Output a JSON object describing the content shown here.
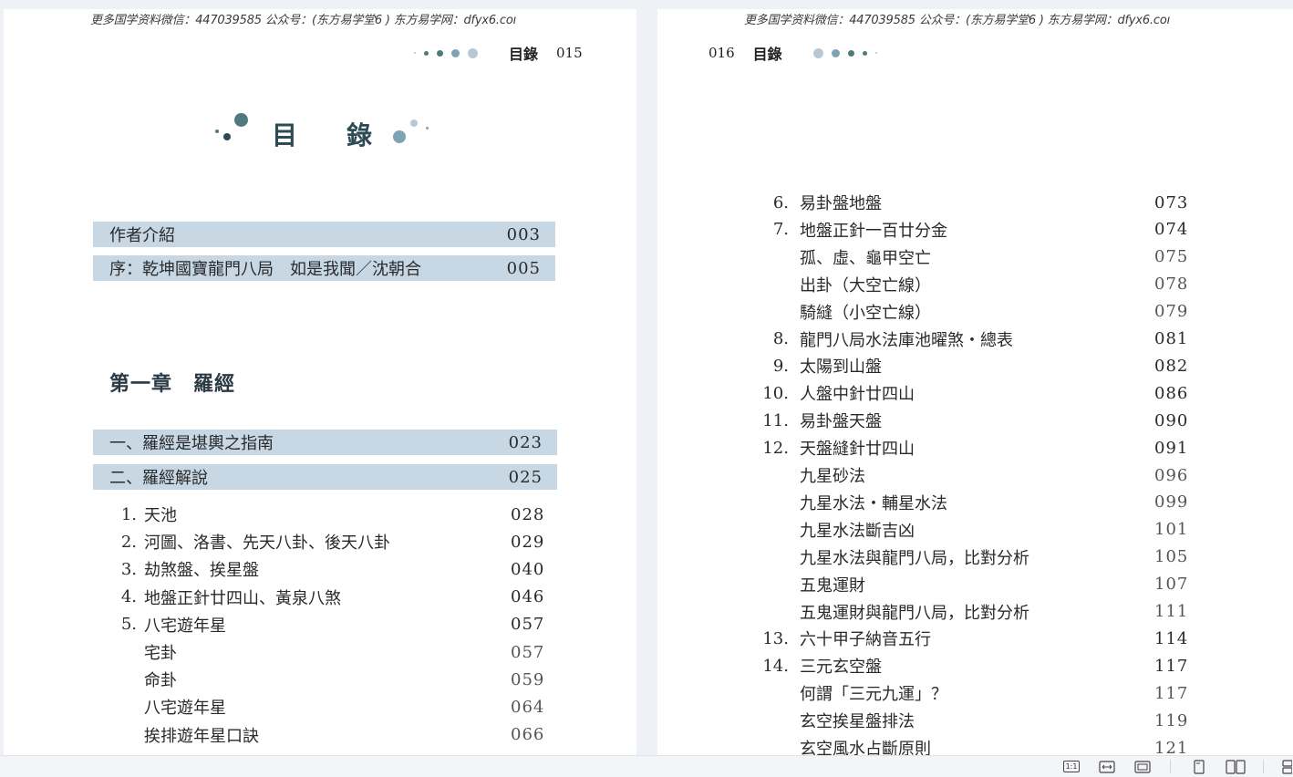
{
  "watermark": "更多国学资料微信：447039585 公众号：(东方易学堂6 ) 东方易学网：dfyx6.coı",
  "left_page": {
    "header_label": "目錄",
    "header_number": "015",
    "title_char_1": "目",
    "title_char_2": "錄",
    "highlighted": [
      {
        "title": "作者介紹",
        "page": "003"
      },
      {
        "title": "序：乾坤國寶龍門八局　如是我聞／沈朝合",
        "page": "005"
      }
    ],
    "chapter": "第一章　羅經",
    "sections": [
      {
        "title": "一、羅經是堪輿之指南",
        "page": "023"
      },
      {
        "title": "二、羅經解說",
        "page": "025"
      }
    ],
    "entries": [
      {
        "num": "1.",
        "title": "天池",
        "page": "028"
      },
      {
        "num": "2.",
        "title": "河圖、洛書、先天八卦、後天八卦",
        "page": "029"
      },
      {
        "num": "3.",
        "title": "劫煞盤、挨星盤",
        "page": "040"
      },
      {
        "num": "4.",
        "title": "地盤正針廿四山、黃泉八煞",
        "page": "046"
      },
      {
        "num": "5.",
        "title": "八宅遊年星",
        "page": "057"
      },
      {
        "num": "",
        "title": "宅卦",
        "page": "057"
      },
      {
        "num": "",
        "title": "命卦",
        "page": "059"
      },
      {
        "num": "",
        "title": "八宅遊年星",
        "page": "064"
      },
      {
        "num": "",
        "title": "挨排遊年星口訣",
        "page": "066"
      }
    ]
  },
  "right_page": {
    "header_number": "016",
    "header_label": "目錄",
    "entries": [
      {
        "num": "6.",
        "title": "易卦盤地盤",
        "page": "073"
      },
      {
        "num": "7.",
        "title": "地盤正針一百廿分金",
        "page": "074"
      },
      {
        "num": "",
        "title": "孤、虛、龜甲空亡",
        "page": "075"
      },
      {
        "num": "",
        "title": "出卦（大空亡線）",
        "page": "078"
      },
      {
        "num": "",
        "title": "騎縫（小空亡線）",
        "page": "079"
      },
      {
        "num": "8.",
        "title": "龍門八局水法庫池曜煞‧總表",
        "page": "081"
      },
      {
        "num": "9.",
        "title": "太陽到山盤",
        "page": "082"
      },
      {
        "num": "10.",
        "title": "人盤中針廿四山",
        "page": "086"
      },
      {
        "num": "11.",
        "title": "易卦盤天盤",
        "page": "090"
      },
      {
        "num": "12.",
        "title": "天盤縫針廿四山",
        "page": "091"
      },
      {
        "num": "",
        "title": "九星砂法",
        "page": "096"
      },
      {
        "num": "",
        "title": "九星水法‧輔星水法",
        "page": "099"
      },
      {
        "num": "",
        "title": "九星水法斷吉凶",
        "page": "101"
      },
      {
        "num": "",
        "title": "九星水法與龍門八局，比對分析",
        "page": "105"
      },
      {
        "num": "",
        "title": "五鬼運財",
        "page": "107"
      },
      {
        "num": "",
        "title": "五鬼運財與龍門八局，比對分析",
        "page": "111"
      },
      {
        "num": "13.",
        "title": "六十甲子納音五行",
        "page": "114"
      },
      {
        "num": "14.",
        "title": "三元玄空盤",
        "page": "117"
      },
      {
        "num": "",
        "title": "何謂「三元九運」？",
        "page": "117"
      },
      {
        "num": "",
        "title": "玄空挨星盤排法",
        "page": "119"
      },
      {
        "num": "",
        "title": "玄空風水占斷原則",
        "page": "121"
      }
    ]
  },
  "toolbar": {
    "actual_size_label": "1:1",
    "icons": [
      "actual-size-icon",
      "fit-width-icon",
      "fit-page-icon",
      "single-page-icon",
      "two-page-icon",
      "continuous-scroll-icon"
    ]
  },
  "colors": {
    "highlight": "#c7d7e4",
    "dot_dark": "#4f7a7c",
    "dot_mid": "#7ea3b3",
    "dot_light": "#b7c8d4"
  }
}
